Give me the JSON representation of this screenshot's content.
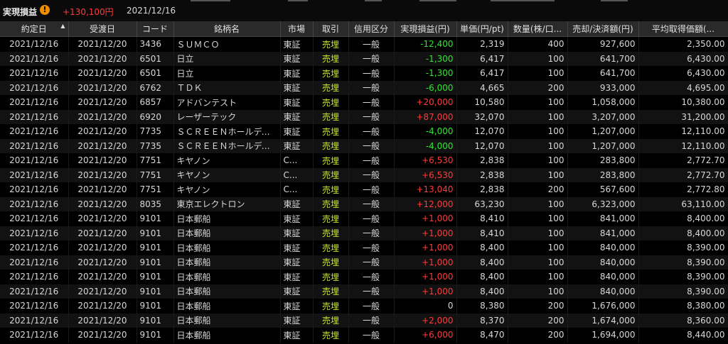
{
  "summary": {
    "label": "実現損益",
    "pnl": "+130,100円",
    "date": "2021/12/16"
  },
  "columns": [
    "約定日",
    "受渡日",
    "コード",
    "銘柄名",
    "市場",
    "取引",
    "信用区分",
    "実現損益(円)",
    "単価(円/pt)",
    "数量(株/口...",
    "売却/決済額(円)",
    "平均取得価額(..."
  ],
  "rows": [
    [
      "2021/12/16",
      "2021/12/20",
      "3436",
      "ＳＵＭＣＯ",
      "東証",
      "売埋",
      "一般",
      "-12,400",
      "2,319",
      "400",
      "927,600",
      "2,350.00"
    ],
    [
      "2021/12/16",
      "2021/12/20",
      "6501",
      "日立",
      "東証",
      "売埋",
      "一般",
      "-1,300",
      "6,417",
      "100",
      "641,700",
      "6,430.00"
    ],
    [
      "2021/12/16",
      "2021/12/20",
      "6501",
      "日立",
      "東証",
      "売埋",
      "一般",
      "-1,300",
      "6,417",
      "100",
      "641,700",
      "6,430.00"
    ],
    [
      "2021/12/16",
      "2021/12/20",
      "6762",
      "ＴＤＫ",
      "東証",
      "売埋",
      "一般",
      "-6,000",
      "4,665",
      "200",
      "933,000",
      "4,695.00"
    ],
    [
      "2021/12/16",
      "2021/12/20",
      "6857",
      "アドバンテスト",
      "東証",
      "売埋",
      "一般",
      "+20,000",
      "10,580",
      "100",
      "1,058,000",
      "10,380.00"
    ],
    [
      "2021/12/16",
      "2021/12/20",
      "6920",
      "レーザーテック",
      "東証",
      "売埋",
      "一般",
      "+87,000",
      "32,070",
      "100",
      "3,207,000",
      "31,200.00"
    ],
    [
      "2021/12/16",
      "2021/12/20",
      "7735",
      "ＳＣＲＥＥＮホールディ...",
      "東証",
      "売埋",
      "一般",
      "-4,000",
      "12,070",
      "100",
      "1,207,000",
      "12,110.00"
    ],
    [
      "2021/12/16",
      "2021/12/20",
      "7735",
      "ＳＣＲＥＥＮホールディ...",
      "東証",
      "売埋",
      "一般",
      "-4,000",
      "12,070",
      "100",
      "1,207,000",
      "12,110.00"
    ],
    [
      "2021/12/16",
      "2021/12/20",
      "7751",
      "キヤノン",
      "C...",
      "売埋",
      "一般",
      "+6,530",
      "2,838",
      "100",
      "283,800",
      "2,772.70"
    ],
    [
      "2021/12/16",
      "2021/12/20",
      "7751",
      "キヤノン",
      "C...",
      "売埋",
      "一般",
      "+6,530",
      "2,838",
      "100",
      "283,800",
      "2,772.70"
    ],
    [
      "2021/12/16",
      "2021/12/20",
      "7751",
      "キヤノン",
      "C...",
      "売埋",
      "一般",
      "+13,040",
      "2,838",
      "200",
      "567,600",
      "2,772.80"
    ],
    [
      "2021/12/16",
      "2021/12/20",
      "8035",
      "東京エレクトロン",
      "東証",
      "売埋",
      "一般",
      "+12,000",
      "63,230",
      "100",
      "6,323,000",
      "63,110.00"
    ],
    [
      "2021/12/16",
      "2021/12/20",
      "9101",
      "日本郵船",
      "東証",
      "売埋",
      "一般",
      "+1,000",
      "8,410",
      "100",
      "841,000",
      "8,400.00"
    ],
    [
      "2021/12/16",
      "2021/12/20",
      "9101",
      "日本郵船",
      "東証",
      "売埋",
      "一般",
      "+1,000",
      "8,410",
      "100",
      "841,000",
      "8,400.00"
    ],
    [
      "2021/12/16",
      "2021/12/20",
      "9101",
      "日本郵船",
      "東証",
      "売埋",
      "一般",
      "+1,000",
      "8,400",
      "100",
      "840,000",
      "8,390.00"
    ],
    [
      "2021/12/16",
      "2021/12/20",
      "9101",
      "日本郵船",
      "東証",
      "売埋",
      "一般",
      "+1,000",
      "8,400",
      "100",
      "840,000",
      "8,390.00"
    ],
    [
      "2021/12/16",
      "2021/12/20",
      "9101",
      "日本郵船",
      "東証",
      "売埋",
      "一般",
      "+1,000",
      "8,400",
      "100",
      "840,000",
      "8,390.00"
    ],
    [
      "2021/12/16",
      "2021/12/20",
      "9101",
      "日本郵船",
      "東証",
      "売埋",
      "一般",
      "+1,000",
      "8,400",
      "100",
      "840,000",
      "8,390.00"
    ],
    [
      "2021/12/16",
      "2021/12/20",
      "9101",
      "日本郵船",
      "東証",
      "売埋",
      "一般",
      "0",
      "8,380",
      "200",
      "1,676,000",
      "8,380.00"
    ],
    [
      "2021/12/16",
      "2021/12/20",
      "9101",
      "日本郵船",
      "東証",
      "売埋",
      "一般",
      "+2,000",
      "8,370",
      "200",
      "1,674,000",
      "8,360.00"
    ],
    [
      "2021/12/16",
      "2021/12/20",
      "9101",
      "日本郵船",
      "東証",
      "売埋",
      "一般",
      "+6,000",
      "8,470",
      "200",
      "1,694,000",
      "8,440.00"
    ]
  ],
  "colors": {
    "positive": "#ff3b3b",
    "negative": "#2ee82e",
    "side": "#c8e632",
    "header_bg": "#2a2a2a"
  },
  "icons": {
    "warning": "warning-icon",
    "sort": "sort-ascending-icon"
  }
}
